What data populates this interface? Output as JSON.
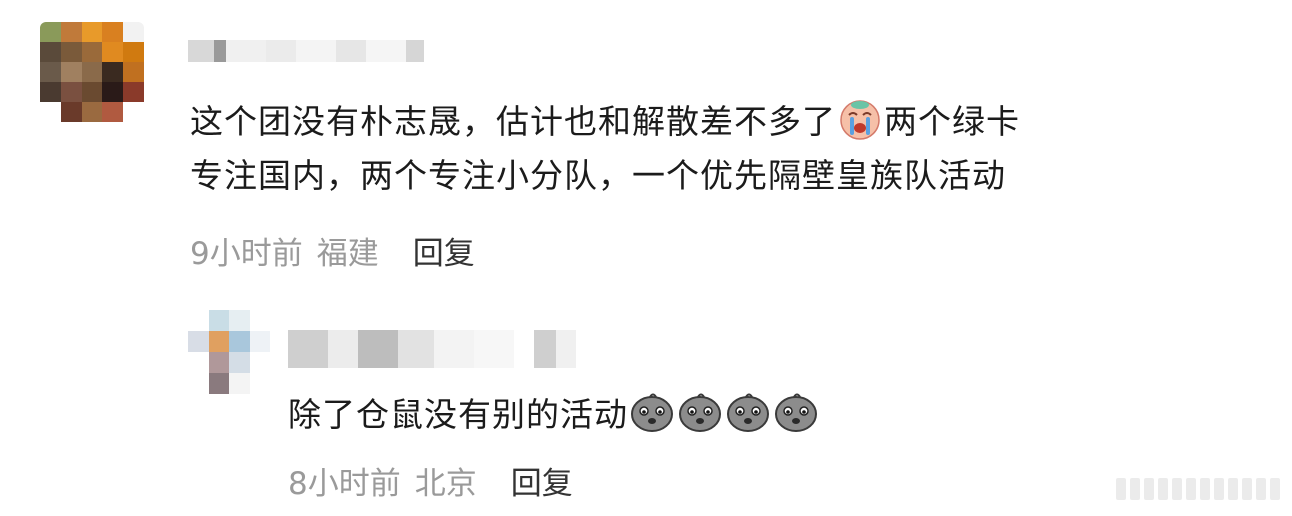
{
  "comments": [
    {
      "text_line1": "这个团没有朴志晟，估计也和解散差不多了",
      "text_line1_after": "两个绿卡",
      "text_line2": "专注国内，两个专注小分队，一个优先隔壁皇族队活动",
      "time": "9小时前",
      "location": "福建",
      "reply_label": "回复",
      "emoji_icon": "crying-face-icon"
    },
    {
      "text": "除了仓鼠没有别的活动",
      "time": "8小时前",
      "location": "北京",
      "reply_label": "回复",
      "emoji_icon": "sad-potato-icon",
      "emoji_count": 4
    }
  ],
  "colors": {
    "text": "#1b1b1b",
    "meta": "#9a9a9a",
    "reply": "#333333"
  }
}
